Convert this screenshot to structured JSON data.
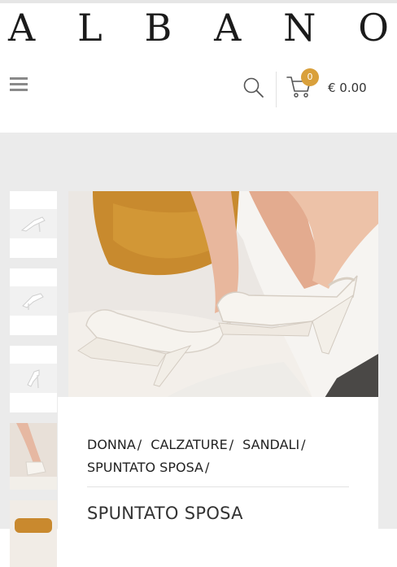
{
  "brand": {
    "letters": [
      "A",
      "L",
      "B",
      "A",
      "N",
      "O"
    ]
  },
  "header": {
    "menu_icon": "hamburger-icon",
    "search_icon": "search-icon",
    "cart_icon": "cart-icon",
    "cart_count": "0",
    "cart_total": "€ 0.00"
  },
  "gallery": {
    "thumbnails": [
      "thumbnail-1",
      "thumbnail-2",
      "thumbnail-3",
      "thumbnail-4",
      "thumbnail-5"
    ]
  },
  "breadcrumb": {
    "items": [
      "DONNA",
      "CALZATURE",
      "SANDALI",
      "SPUNTATO SPOSA"
    ],
    "separator": "/"
  },
  "product": {
    "title": "SPUNTATO SPOSA"
  },
  "colors": {
    "accent": "#d9a03b",
    "background_gray": "#ebebeb"
  }
}
